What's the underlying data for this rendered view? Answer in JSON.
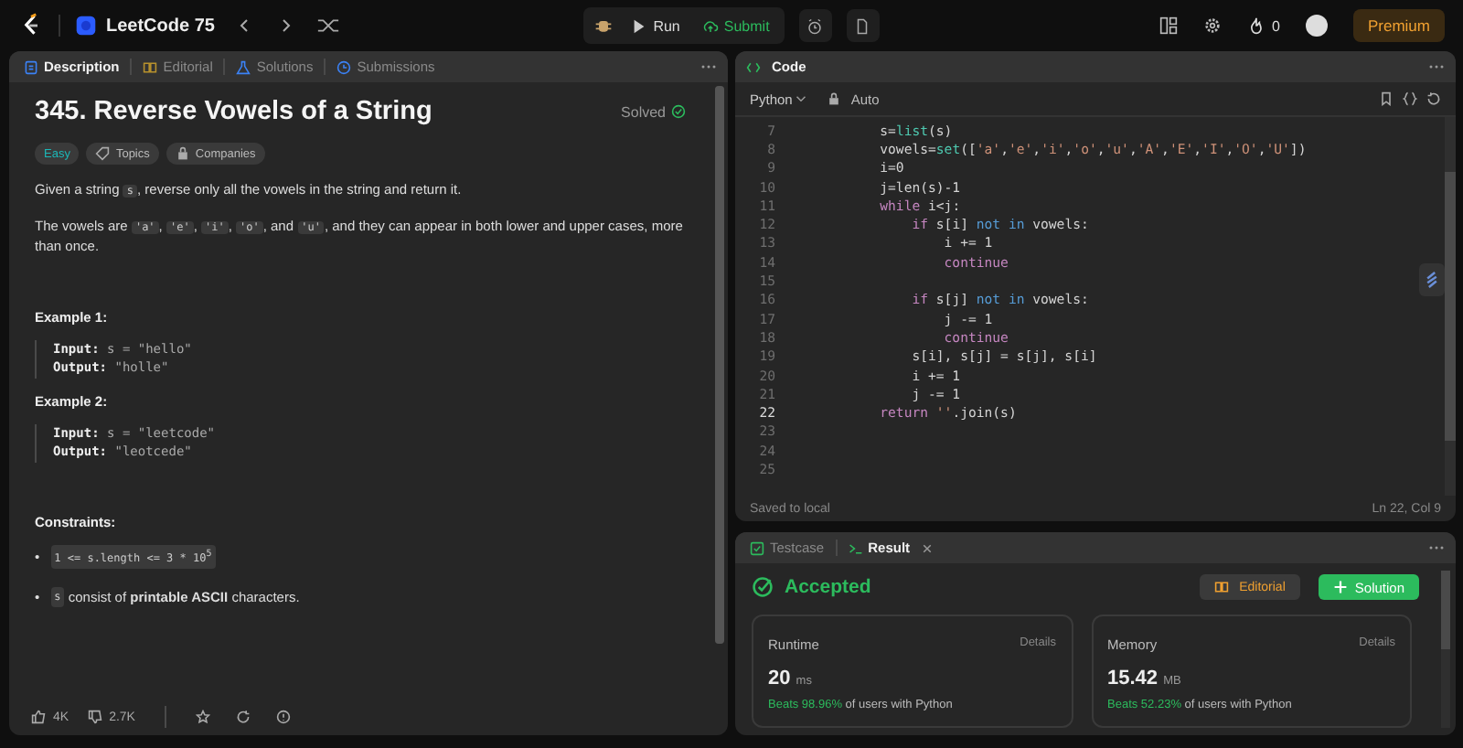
{
  "topbar": {
    "list_title": "LeetCode 75",
    "run": "Run",
    "submit": "Submit",
    "streak": "0",
    "premium": "Premium"
  },
  "description_panel": {
    "tabs": [
      {
        "label": "Description",
        "selected": true,
        "kind": "doc"
      },
      {
        "label": "Editorial",
        "selected": false,
        "kind": "book"
      },
      {
        "label": "Solutions",
        "selected": false,
        "kind": "flask"
      },
      {
        "label": "Submissions",
        "selected": false,
        "kind": "clock"
      }
    ],
    "title": "345. Reverse Vowels of a String",
    "status": "Solved",
    "tags": [
      {
        "label": "Easy",
        "kind": "difficulty"
      },
      {
        "label": "Topics",
        "kind": "topics"
      },
      {
        "label": "Companies",
        "kind": "companies"
      }
    ],
    "paragraphs": [
      [
        {
          "t": "Given a string ",
          "code": false
        },
        {
          "t": "s",
          "code": true
        },
        {
          "t": ", reverse only all the vowels in the string and return it.",
          "code": false
        }
      ],
      [
        {
          "t": "The vowels are ",
          "code": false
        },
        {
          "t": "'a'",
          "code": true
        },
        {
          "t": ", ",
          "code": false
        },
        {
          "t": "'e'",
          "code": true
        },
        {
          "t": ", ",
          "code": false
        },
        {
          "t": "'i'",
          "code": true
        },
        {
          "t": ", ",
          "code": false
        },
        {
          "t": "'o'",
          "code": true
        },
        {
          "t": ", and ",
          "code": false
        },
        {
          "t": "'u'",
          "code": true
        },
        {
          "t": ", and they can appear in both lower and upper cases, more than once.",
          "code": false
        }
      ]
    ],
    "examples": [
      {
        "heading": "Example 1:",
        "input_label": "Input:",
        "input": "s = \"hello\"",
        "output_label": "Output:",
        "output": "\"holle\""
      },
      {
        "heading": "Example 2:",
        "input_label": "Input:",
        "input": "s = \"leetcode\"",
        "output_label": "Output:",
        "output": "\"leotcede\""
      }
    ],
    "constraints_heading": "Constraints:",
    "constraints": [
      {
        "bullet": "•",
        "parts": [
          {
            "t": "1 <= s.length <= 3 * 10$^{5}$",
            "code": true
          }
        ]
      },
      {
        "bullet": "•",
        "parts": [
          {
            "t": "s",
            "code": true
          },
          {
            "t": " consist of **printable ASCII** characters.",
            "code": false
          }
        ]
      }
    ],
    "likes": "4K",
    "dislikes": "2.7K"
  },
  "code_panel": {
    "title": "Code",
    "language": "Python",
    "mode": "Auto",
    "lines": [
      {
        "number": "7",
        "current": false,
        "tokens": [
          {
            "t": "        s=",
            "kind": "plain"
          },
          {
            "t": "list",
            "kind": "builtin"
          },
          {
            "t": "(s)",
            "kind": "plain"
          }
        ]
      },
      {
        "number": "8",
        "current": false,
        "tokens": [
          {
            "t": "        vowels=",
            "kind": "plain"
          },
          {
            "t": "set",
            "kind": "builtin"
          },
          {
            "t": "([",
            "kind": "plain"
          },
          {
            "t": "'a'",
            "kind": "string"
          },
          {
            "t": ",",
            "kind": "plain"
          },
          {
            "t": "'e'",
            "kind": "string"
          },
          {
            "t": ",",
            "kind": "plain"
          },
          {
            "t": "'i'",
            "kind": "string"
          },
          {
            "t": ",",
            "kind": "plain"
          },
          {
            "t": "'o'",
            "kind": "string"
          },
          {
            "t": ",",
            "kind": "plain"
          },
          {
            "t": "'u'",
            "kind": "string"
          },
          {
            "t": ",",
            "kind": "plain"
          },
          {
            "t": "'A'",
            "kind": "string"
          },
          {
            "t": ",",
            "kind": "plain"
          },
          {
            "t": "'E'",
            "kind": "string"
          },
          {
            "t": ",",
            "kind": "plain"
          },
          {
            "t": "'I'",
            "kind": "string"
          },
          {
            "t": ",",
            "kind": "plain"
          },
          {
            "t": "'O'",
            "kind": "string"
          },
          {
            "t": ",",
            "kind": "plain"
          },
          {
            "t": "'U'",
            "kind": "string"
          },
          {
            "t": "])",
            "kind": "plain"
          }
        ]
      },
      {
        "number": "9",
        "current": false,
        "tokens": [
          {
            "t": "        i=0",
            "kind": "plain"
          }
        ]
      },
      {
        "number": "10",
        "current": false,
        "tokens": [
          {
            "t": "        j=len(s)-1",
            "kind": "plain"
          }
        ]
      },
      {
        "number": "11",
        "current": false,
        "tokens": [
          {
            "t": "        while",
            "kind": "control"
          },
          {
            "t": " i<j:",
            "kind": "plain"
          }
        ]
      },
      {
        "number": "12",
        "current": false,
        "tokens": [
          {
            "t": "            if",
            "kind": "control"
          },
          {
            "t": " s[i] ",
            "kind": "plain"
          },
          {
            "t": "not in",
            "kind": "keyword"
          },
          {
            "t": " vowels:",
            "kind": "plain"
          }
        ]
      },
      {
        "number": "13",
        "current": false,
        "tokens": [
          {
            "t": "                i += 1",
            "kind": "plain"
          }
        ]
      },
      {
        "number": "14",
        "current": false,
        "tokens": [
          {
            "t": "                continue",
            "kind": "control"
          }
        ]
      },
      {
        "number": "15",
        "current": false
      },
      {
        "number": "16",
        "current": false,
        "tokens": [
          {
            "t": "            if",
            "kind": "control"
          },
          {
            "t": " s[j] ",
            "kind": "plain"
          },
          {
            "t": "not in",
            "kind": "keyword"
          },
          {
            "t": " vowels:",
            "kind": "plain"
          }
        ]
      },
      {
        "number": "17",
        "current": false,
        "tokens": [
          {
            "t": "                j -= 1",
            "kind": "plain"
          }
        ]
      },
      {
        "number": "18",
        "current": false,
        "tokens": [
          {
            "t": "                continue",
            "kind": "control"
          }
        ]
      },
      {
        "number": "19",
        "current": false,
        "tokens": [
          {
            "t": "            s[i], s[j] = s[j], s[i]",
            "kind": "plain"
          }
        ]
      },
      {
        "number": "20",
        "current": false,
        "tokens": [
          {
            "t": "            i += 1",
            "kind": "plain"
          }
        ]
      },
      {
        "number": "21",
        "current": false,
        "tokens": [
          {
            "t": "            j -= 1",
            "kind": "plain"
          }
        ]
      },
      {
        "number": "22",
        "current": true,
        "tokens": [
          {
            "t": "        return",
            "kind": "control"
          },
          {
            "t": " ''",
            "kind": "string"
          },
          {
            "t": ".join(s)",
            "kind": "plain"
          }
        ]
      },
      {
        "number": "23",
        "current": false
      },
      {
        "number": "24",
        "current": false
      },
      {
        "number": "25",
        "current": false
      }
    ],
    "status": "Saved to local",
    "cursor": "Ln 22, Col 9"
  },
  "result_panel": {
    "tabs": [
      {
        "label": "Testcase",
        "selected": false,
        "kind": "check"
      },
      {
        "label": "Result",
        "selected": true,
        "kind": "terminal"
      }
    ],
    "verdict": "Accepted",
    "editorial": "Editorial",
    "solution": "Solution",
    "metrics": [
      {
        "label": "Runtime",
        "details": "Details",
        "value": "20",
        "unit": "ms",
        "beats": "Beats 98.96%",
        "beats_rest": "of users with Python"
      },
      {
        "label": "Memory",
        "details": "Details",
        "value": "15.42",
        "unit": "MB",
        "beats": "Beats 52.23%",
        "beats_rest": "of users with Python"
      }
    ]
  }
}
